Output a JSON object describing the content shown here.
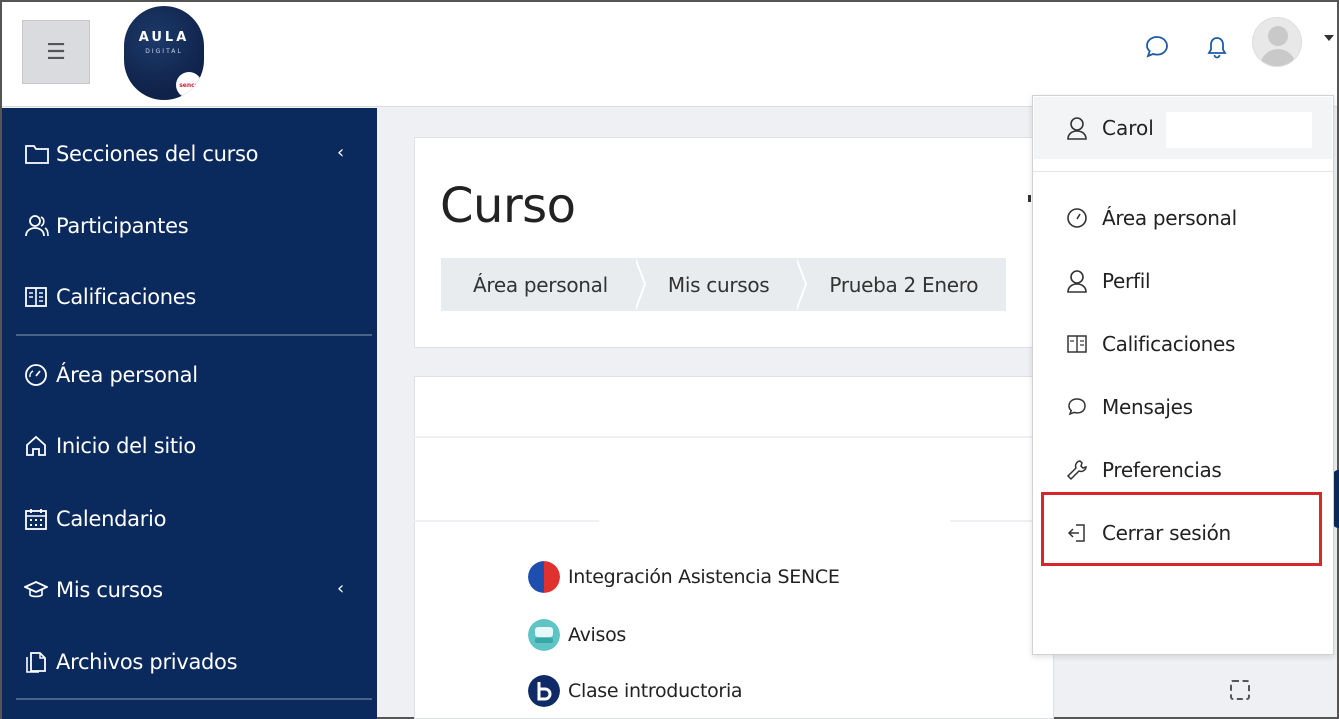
{
  "header": {
    "menu_icon": "hamburger-icon",
    "logo": {
      "line1": "AULA",
      "line2": "DIGITAL",
      "badge": "sence"
    },
    "icons": [
      "message-icon",
      "bell-icon",
      "user-avatar",
      "caret-down-icon"
    ]
  },
  "sidebar": {
    "items": [
      {
        "label": "Secciones del curso",
        "icon": "folder-icon",
        "expandable": true
      },
      {
        "label": "Participantes",
        "icon": "users-icon"
      },
      {
        "label": "Calificaciones",
        "icon": "gradebook-icon"
      },
      {
        "label": "Área personal",
        "icon": "dashboard-icon"
      },
      {
        "label": "Inicio del sitio",
        "icon": "home-icon"
      },
      {
        "label": "Calendario",
        "icon": "calendar-icon"
      },
      {
        "label": "Mis cursos",
        "icon": "graduation-cap-icon",
        "expandable": true
      },
      {
        "label": "Archivos privados",
        "icon": "files-icon"
      }
    ],
    "chevron": "‹"
  },
  "main": {
    "title": "Curso",
    "breadcrumb": [
      "Área personal",
      "Mis cursos",
      "Prueba 2 Enero"
    ],
    "activities": [
      {
        "label": "Integración Asistencia SENCE",
        "icon": "sence-icon"
      },
      {
        "label": "Avisos",
        "icon": "forum-icon"
      },
      {
        "label": "Clase introductoria",
        "icon": "bigbluebutton-icon"
      }
    ]
  },
  "user_menu": {
    "user_name": "Carol",
    "items": [
      {
        "label": "Área personal",
        "icon": "dashboard-icon"
      },
      {
        "label": "Perfil",
        "icon": "user-icon"
      },
      {
        "label": "Calificaciones",
        "icon": "gradebook-icon"
      },
      {
        "label": "Mensajes",
        "icon": "message-icon"
      },
      {
        "label": "Preferencias",
        "icon": "wrench-icon"
      },
      {
        "label": "Cerrar sesión",
        "icon": "logout-icon",
        "highlighted": true
      }
    ]
  },
  "colors": {
    "sidebar_bg": "#0a2a5e",
    "highlight": "#d7262e",
    "page_bg": "#eef0f4"
  }
}
